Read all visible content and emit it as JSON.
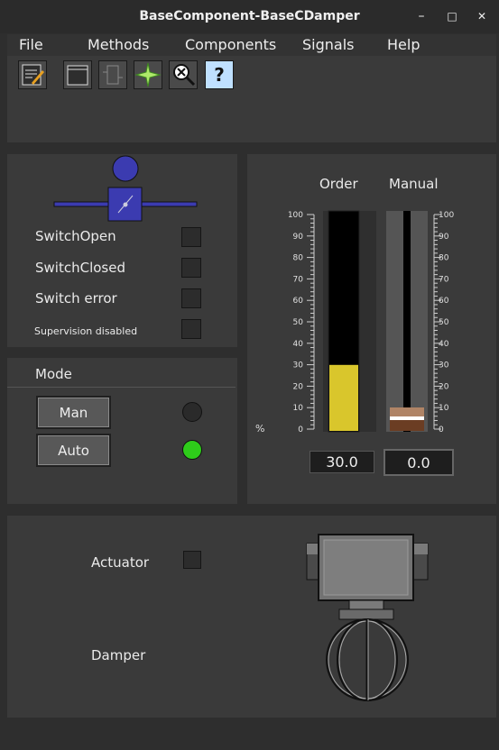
{
  "window": {
    "title": "BaseComponent-BaseCDamper",
    "minimize": "–",
    "maximize": "□",
    "close": "✕"
  },
  "menu": {
    "file": "File",
    "methods": "Methods",
    "components": "Components",
    "signals": "Signals",
    "help": "Help"
  },
  "toolbar": {
    "icons": [
      "notes-icon",
      "window-icon",
      "component-icon",
      "trend-icon",
      "zoom-close-icon",
      "help-icon"
    ],
    "help_glyph": "?"
  },
  "status": {
    "switch_open": "SwitchOpen",
    "switch_closed": "SwitchClosed",
    "switch_error": "Switch error",
    "supervision_disabled": "Supervision disabled"
  },
  "mode": {
    "title": "Mode",
    "man_label": "Man",
    "auto_label": "Auto",
    "man_active": false,
    "auto_active": true,
    "active_color": "#2ecc1a",
    "inactive_color": "#2a2a2a"
  },
  "gauges": {
    "order_label": "Order",
    "manual_label": "Manual",
    "unit": "%",
    "ticks": [
      "100",
      "90",
      "80",
      "70",
      "60",
      "50",
      "40",
      "30",
      "20",
      "10",
      "0"
    ],
    "order_value": 30,
    "order_text": "30.0",
    "manual_value": 0,
    "manual_text": "0.0",
    "order_color": "#d9c62c"
  },
  "bottom": {
    "actuator_label": "Actuator",
    "damper_label": "Damper"
  },
  "colors": {
    "accent": "#3b3bb0"
  }
}
